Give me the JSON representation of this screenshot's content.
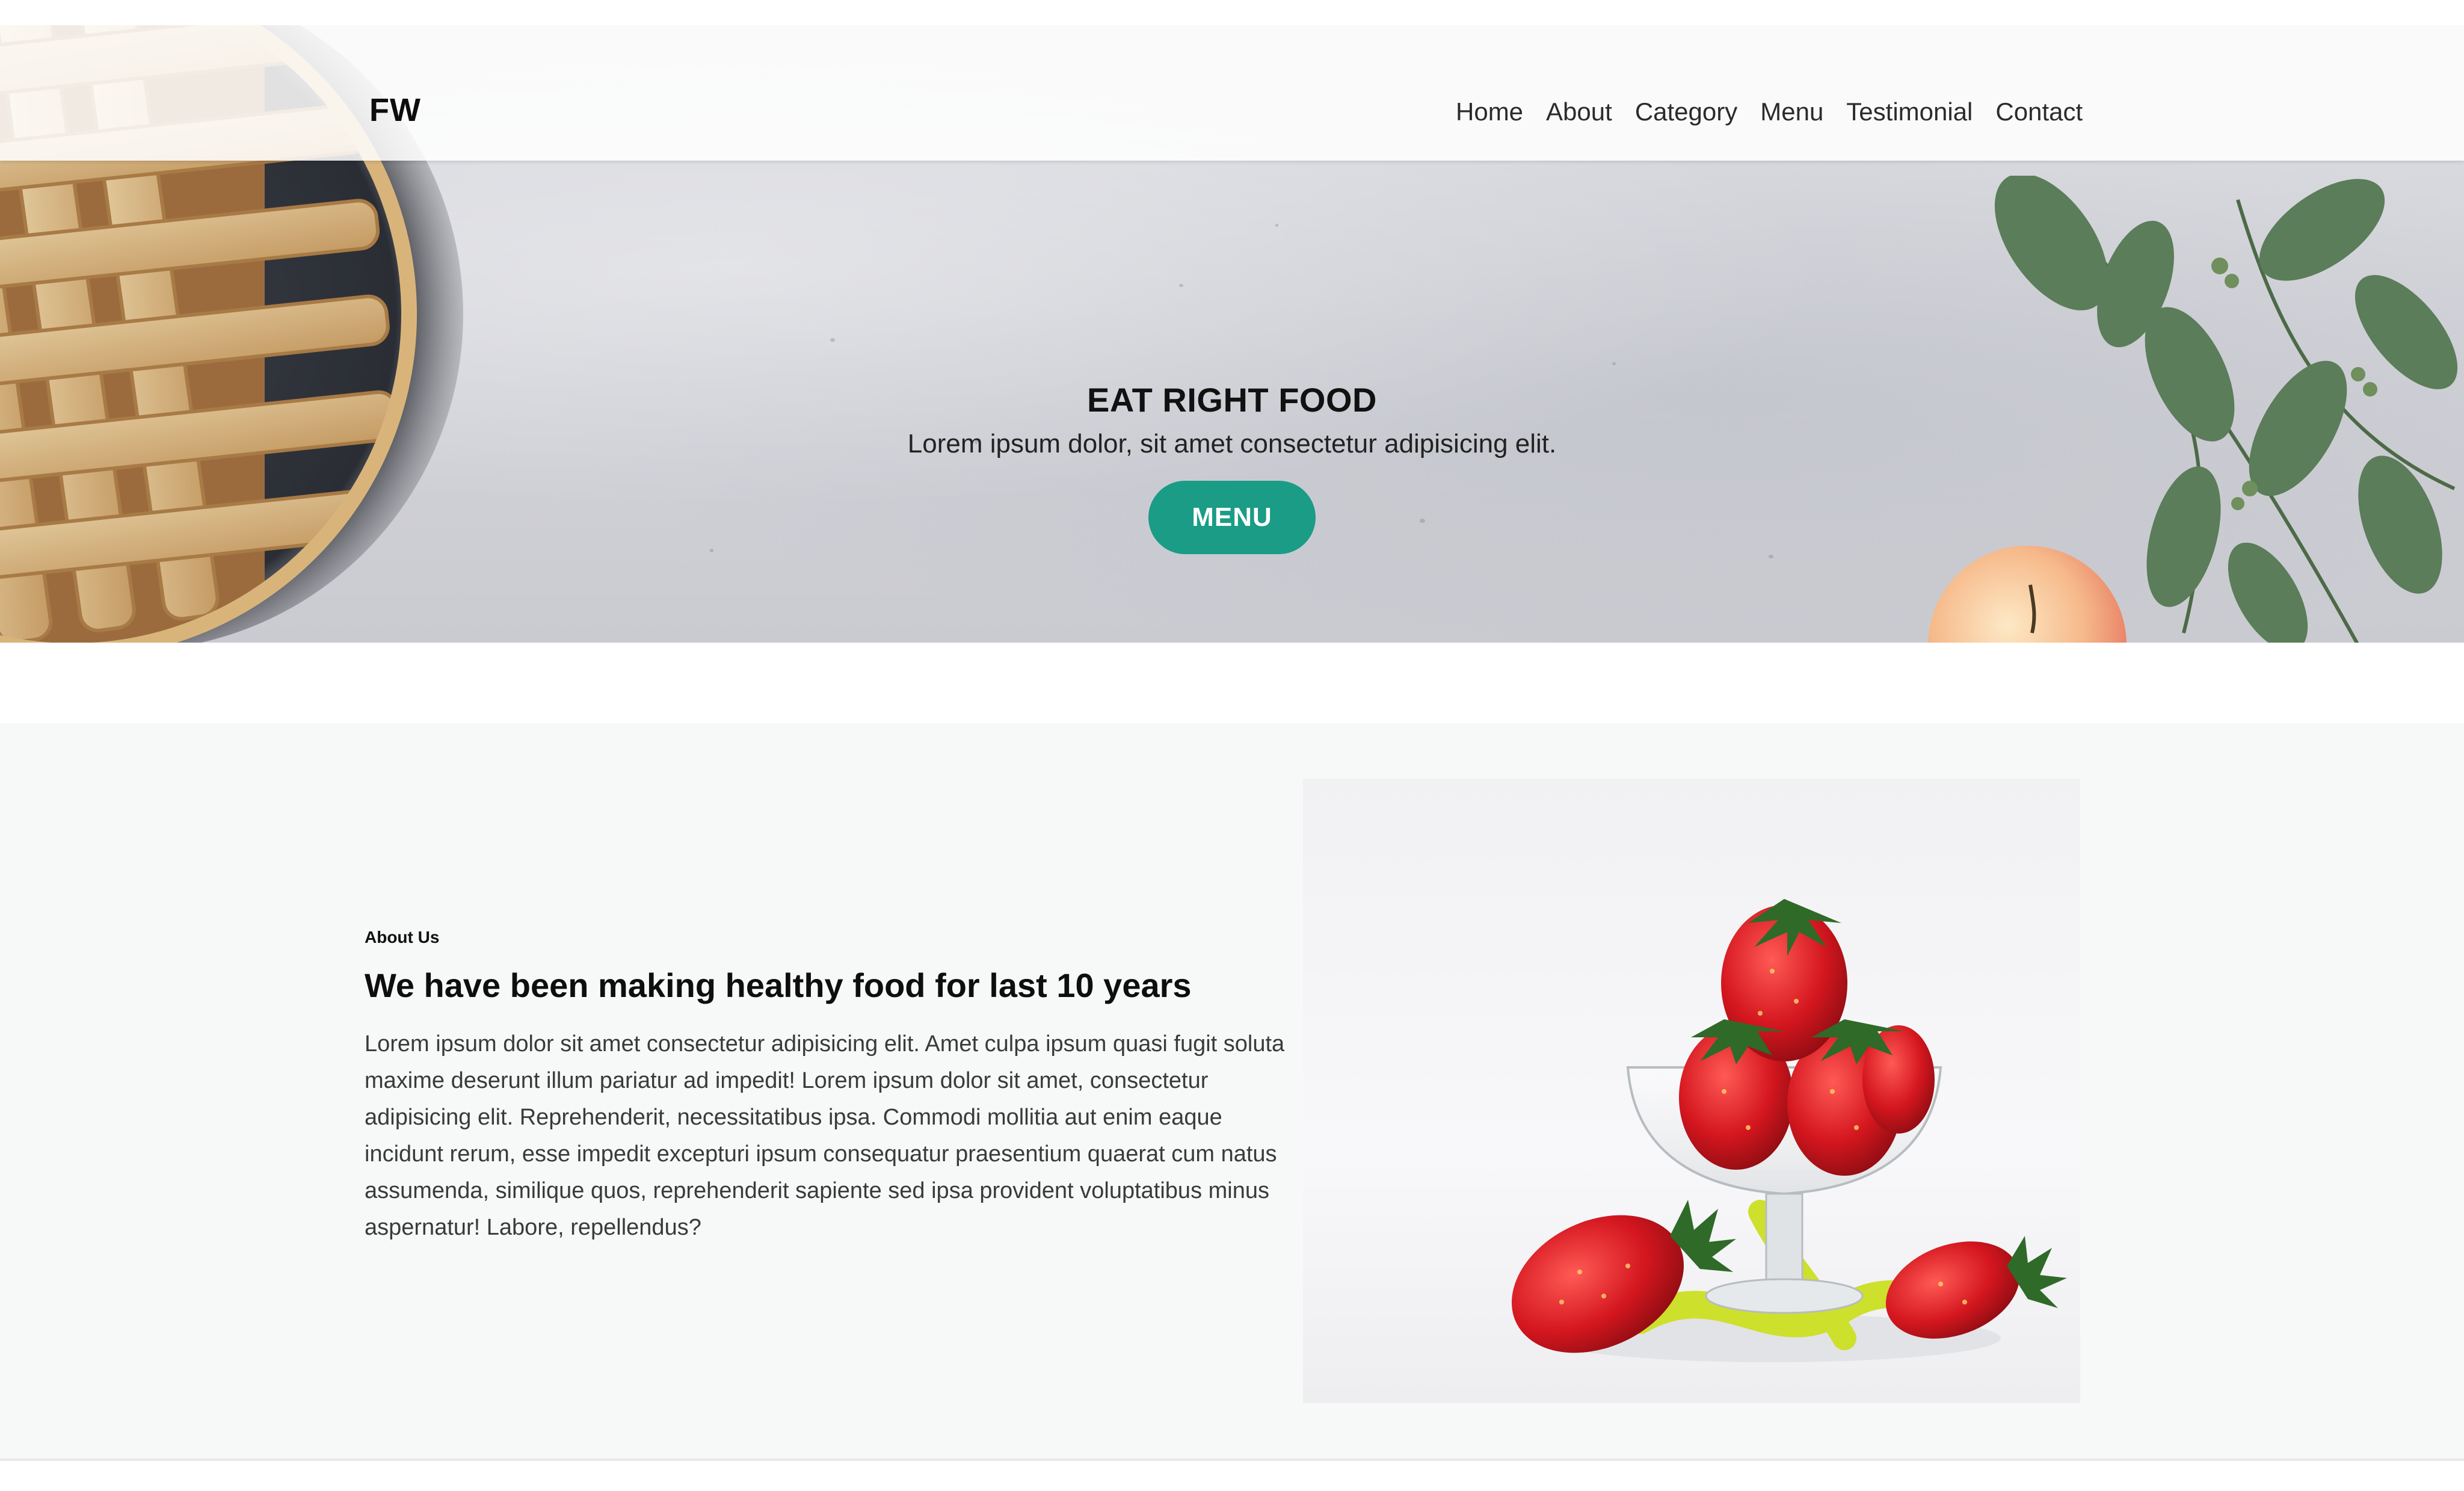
{
  "header": {
    "brand": "FW",
    "nav": [
      "Home",
      "About",
      "Category",
      "Menu",
      "Testimonial",
      "Contact"
    ]
  },
  "hero": {
    "title": "EAT RIGHT FOOD",
    "subtitle": "Lorem ipsum dolor, sit amet consectetur adipisicing elit.",
    "button_label": "MENU",
    "accent_color": "#1a9c86"
  },
  "about": {
    "kicker": "About Us",
    "title": "We have been making healthy food for last 10 years",
    "body": "Lorem ipsum dolor sit amet consectetur adipisicing elit. Amet culpa ipsum quasi fugit soluta maxime deserunt illum pariatur ad impedit! Lorem ipsum dolor sit amet, consectetur adipisicing elit. Reprehenderit, necessitatibus ipsa. Commodi mollitia aut enim eaque incidunt rerum, esse impedit excepturi ipsum consequatur praesentium quaerat cum natus assumenda, similique quos, reprehenderit sapiente sed ipsa provident voluptatibus minus aspernatur! Labore, repellendus?"
  }
}
